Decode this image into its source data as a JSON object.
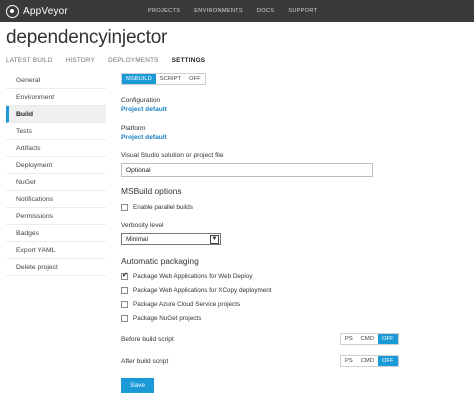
{
  "app": {
    "name": "AppVeyor"
  },
  "topnav": [
    "PROJECTS",
    "ENVIRONMENTS",
    "DOCS",
    "SUPPORT"
  ],
  "project": {
    "title": "dependencyinjector"
  },
  "tabs": [
    "LATEST BUILD",
    "HISTORY",
    "DEPLOYMENTS",
    "SETTINGS"
  ],
  "active_tab": "SETTINGS",
  "sidebar": [
    "General",
    "Environment",
    "Build",
    "Tests",
    "Artifacts",
    "Deployment",
    "NuGet",
    "Notifications",
    "Permissions",
    "Badges",
    "Export YAML",
    "Delete project"
  ],
  "active_sidebar": "Build",
  "build_mode": {
    "options": [
      "MSBUILD",
      "SCRIPT",
      "OFF"
    ],
    "selected": "MSBUILD"
  },
  "configuration": {
    "label": "Configuration",
    "value": "Project default"
  },
  "platform": {
    "label": "Platform",
    "value": "Project default"
  },
  "solution": {
    "label": "Visual Studio solution or project file",
    "value": "Optional"
  },
  "msbuild_options": {
    "heading": "MSBuild options",
    "parallel_label": "Enable parallel builds",
    "parallel_checked": false,
    "verbosity_label": "Verbosity level",
    "verbosity_value": "Minimal"
  },
  "packaging": {
    "heading": "Automatic packaging",
    "items": [
      {
        "label": "Package Web Applications for Web Deploy",
        "checked": true
      },
      {
        "label": "Package Web Applications for XCopy deployment",
        "checked": false
      },
      {
        "label": "Package Azure Cloud Service projects",
        "checked": false
      },
      {
        "label": "Package NuGet projects",
        "checked": false
      }
    ]
  },
  "before_script": {
    "label": "Before build script",
    "options": [
      "PS",
      "CMD",
      "OFF"
    ],
    "selected": "OFF"
  },
  "after_script": {
    "label": "After build script",
    "options": [
      "PS",
      "CMD",
      "OFF"
    ],
    "selected": "OFF"
  },
  "save_label": "Save",
  "colors": {
    "accent": "#1a9ad6",
    "topbar": "#3a3a3a",
    "link": "#1a7fc1"
  },
  "icons": {
    "logo": "appveyor-logo-icon",
    "dropdown": "chevron-down-icon",
    "check": "check-icon"
  }
}
